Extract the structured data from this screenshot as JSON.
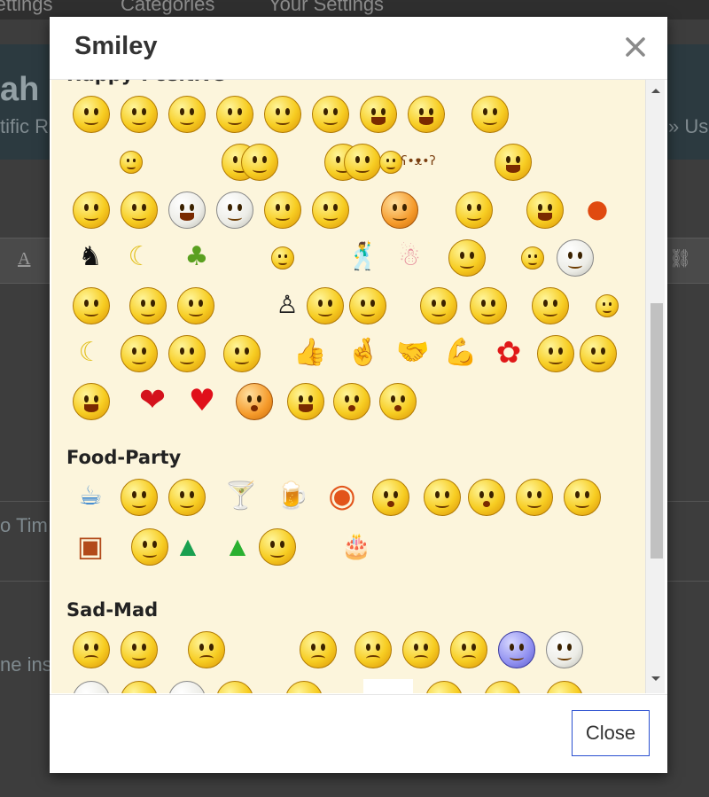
{
  "background": {
    "nav_items": [
      "Settings",
      "Categories",
      "Your Settings"
    ],
    "fragments": [
      "ah",
      "tific R",
      "» Us",
      "o Tim",
      "ne ins"
    ],
    "toolbar_letter": "A"
  },
  "dialog": {
    "title": "Smiley",
    "close_icon": "close-icon",
    "close_button_label": "Close",
    "accent_color": "#2a4fd0",
    "body_background": "#fcf5dc"
  },
  "categories": [
    {
      "title": "Happy-Positive",
      "rows": [
        [
          "smile",
          "wink-smile",
          "sun-smile",
          "sly-smile",
          "smirk",
          "plain-smile",
          "goofy-grin",
          "big-grin",
          "winged-smile"
        ],
        [
          "tiny-wave",
          "bubble-group",
          "two-faces",
          "faces-talking",
          "teddy-bear",
          "laughing"
        ],
        [
          "thinking-hand",
          "hand-to-mouth",
          "white-laugh",
          "white-grin",
          "peeking",
          "kiss-face",
          "duo-hug",
          "blush-sly",
          "cheering",
          "strawberry"
        ],
        [
          "ninja",
          "banana-dance",
          "pickle-dance",
          "whistling",
          "dancer-silhouette",
          "pink-figure",
          "cool-shades",
          "shades-dude",
          "blue-shades"
        ],
        [
          "nerd-face",
          "glasses-smile",
          "hands-up",
          "businessman",
          "angel",
          "winged-angel",
          "praying",
          "thumbs-smile",
          "waving-hand",
          "jumping"
        ],
        [
          "banana-peel",
          "thinking-chin",
          "rubbing-hands",
          "thumbs-up-face",
          "thumbs-up",
          "crossed-fingers",
          "handshake",
          "muscle",
          "flower",
          "heart-kiss",
          "love-face"
        ],
        [
          "love-grin",
          "heart-face",
          "red-heart",
          "lips-kiss",
          "happy-face",
          "drooling",
          "looking-up"
        ]
      ]
    },
    {
      "title": "Food-Party",
      "rows": [
        [
          "coffee-mug",
          "coffee-face",
          "computer-face",
          "cocktail",
          "beer-mug",
          "pizza",
          "tongue-out",
          "plain-face",
          "drunk",
          "party-girl",
          "party-drink"
        ],
        [
          "pie-box",
          "pie-face",
          "party-hat",
          "green-party-hat",
          "party-horn",
          "birthday-cake"
        ]
      ]
    },
    {
      "title": "Sad-Mad",
      "rows": [
        [
          "face-palm",
          "hands-over-face",
          "winged-sad",
          "grumpy",
          "worried",
          "neutral",
          "frown",
          "blue-face",
          "rolling-eyes"
        ],
        [
          "goggle-eyes",
          "hiding",
          "staring",
          "clapping-sad",
          "arms-out",
          "white-box",
          "cranky",
          "spiky",
          "glum"
        ]
      ]
    }
  ]
}
